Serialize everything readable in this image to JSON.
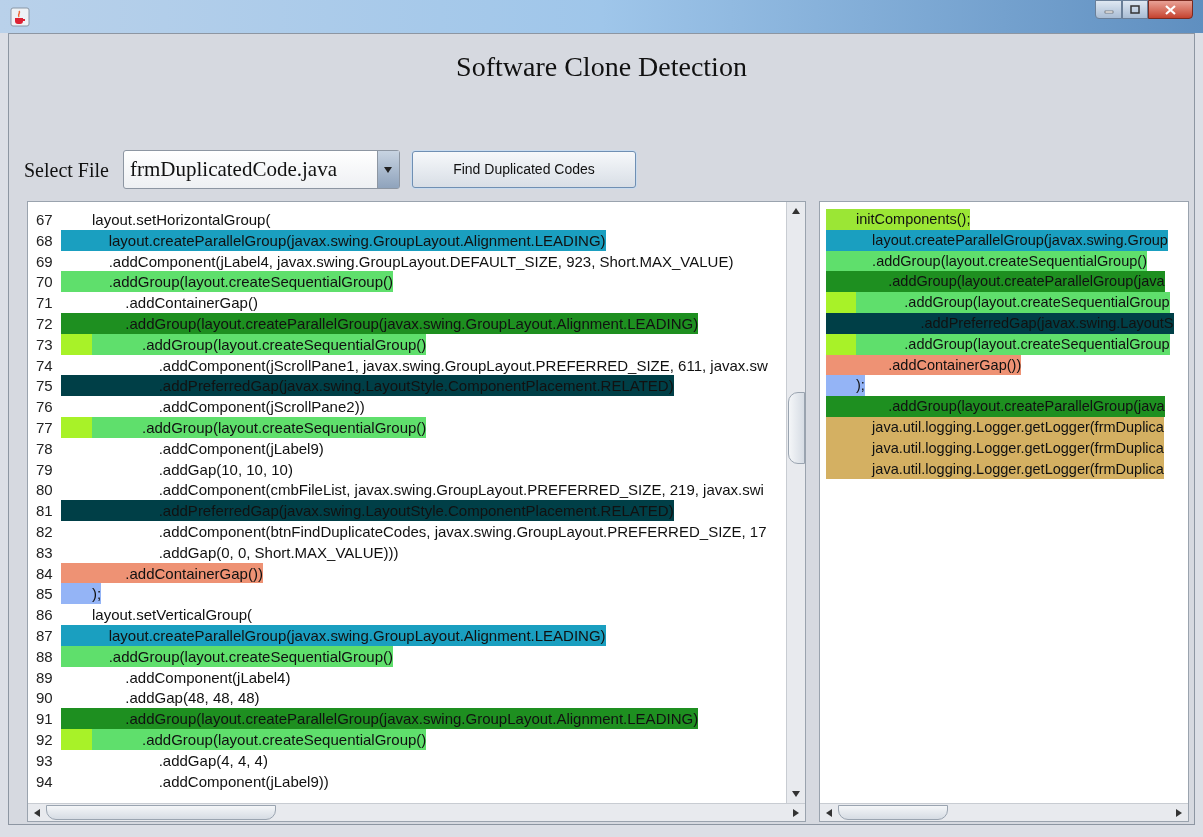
{
  "title": "Software Clone Detection",
  "select_file": {
    "label": "Select File",
    "value": "frmDuplicatedCode.java"
  },
  "buttons": [
    "Find Duplicated Codes"
  ],
  "source_pane": {
    "lines": [
      {
        "number": "67",
        "text": "layout.setHorizontalGroup(",
        "marked": false
      },
      {
        "number": "68",
        "text": "    layout.createParallelGroup(javax.swing.GroupLayout.Alignment.LEADING)",
        "color": "#1a9fc0",
        "marked": false
      },
      {
        "number": "69",
        "text": "    .addComponent(jLabel4, javax.swing.GroupLayout.DEFAULT_SIZE, 923, Short.MAX_VALUE)",
        "marked": false
      },
      {
        "number": "70",
        "text": "    .addGroup(layout.createSequentialGroup()",
        "color": "#5fdf6c",
        "marked": false
      },
      {
        "number": "71",
        "text": "        .addContainerGap()",
        "marked": false
      },
      {
        "number": "72",
        "text": "        .addGroup(layout.createParallelGroup(javax.swing.GroupLayout.Alignment.LEADING)",
        "color": "#1e8f20",
        "marked": false
      },
      {
        "number": "73",
        "text": "            .addGroup(layout.createSequentialGroup()",
        "color": "#5fdf6c",
        "marked": true
      },
      {
        "number": "74",
        "text": "                .addComponent(jScrollPane1, javax.swing.GroupLayout.PREFERRED_SIZE, 611, javax.sw",
        "marked": false
      },
      {
        "number": "75",
        "text": "                .addPreferredGap(javax.swing.LayoutStyle.ComponentPlacement.RELATED)",
        "color": "#003f47",
        "marked": false
      },
      {
        "number": "76",
        "text": "                .addComponent(jScrollPane2))",
        "marked": false
      },
      {
        "number": "77",
        "text": "            .addGroup(layout.createSequentialGroup()",
        "color": "#5fdf6c",
        "marked": true
      },
      {
        "number": "78",
        "text": "                .addComponent(jLabel9)",
        "marked": false
      },
      {
        "number": "79",
        "text": "                .addGap(10, 10, 10)",
        "marked": false
      },
      {
        "number": "80",
        "text": "                .addComponent(cmbFileList, javax.swing.GroupLayout.PREFERRED_SIZE, 219, javax.swi",
        "marked": false
      },
      {
        "number": "81",
        "text": "                .addPreferredGap(javax.swing.LayoutStyle.ComponentPlacement.RELATED)",
        "color": "#003f47",
        "marked": false
      },
      {
        "number": "82",
        "text": "                .addComponent(btnFindDuplicateCodes, javax.swing.GroupLayout.PREFERRED_SIZE, 17",
        "marked": false
      },
      {
        "number": "83",
        "text": "                .addGap(0, 0, Short.MAX_VALUE)))",
        "marked": false
      },
      {
        "number": "84",
        "text": "        .addContainerGap())",
        "color": "#ee9274",
        "marked": false
      },
      {
        "number": "85",
        "text": ");",
        "color": "#94b4f6",
        "marked": false
      },
      {
        "number": "86",
        "text": "layout.setVerticalGroup(",
        "marked": false
      },
      {
        "number": "87",
        "text": "    layout.createParallelGroup(javax.swing.GroupLayout.Alignment.LEADING)",
        "color": "#1a9fc0",
        "marked": false
      },
      {
        "number": "88",
        "text": "    .addGroup(layout.createSequentialGroup()",
        "color": "#5fdf6c",
        "marked": false
      },
      {
        "number": "89",
        "text": "        .addComponent(jLabel4)",
        "marked": false
      },
      {
        "number": "90",
        "text": "        .addGap(48, 48, 48)",
        "marked": false
      },
      {
        "number": "91",
        "text": "        .addGroup(layout.createParallelGroup(javax.swing.GroupLayout.Alignment.LEADING)",
        "color": "#1e8f20",
        "marked": false
      },
      {
        "number": "92",
        "text": "            .addGroup(layout.createSequentialGroup()",
        "color": "#5fdf6c",
        "marked": true
      },
      {
        "number": "93",
        "text": "                .addGap(4, 4, 4)",
        "marked": false
      },
      {
        "number": "94",
        "text": "                .addComponent(jLabel9))",
        "marked": false
      }
    ]
  },
  "clone_pane": {
    "lines": [
      {
        "text": "initComponents();",
        "color": "#9be635",
        "marked": false
      },
      {
        "text": "    layout.createParallelGroup(javax.swing.Group",
        "color": "#1a9fc0",
        "marked": false
      },
      {
        "text": "    .addGroup(layout.createSequentialGroup()",
        "color": "#5fdf6c",
        "marked": false
      },
      {
        "text": "        .addGroup(layout.createParallelGroup(java",
        "color": "#1e8f20",
        "marked": false
      },
      {
        "text": "            .addGroup(layout.createSequentialGroup",
        "color": "#5fdf6c",
        "marked": true
      },
      {
        "text": "                .addPreferredGap(javax.swing.LayoutS",
        "color": "#003f47",
        "marked": false
      },
      {
        "text": "            .addGroup(layout.createSequentialGroup",
        "color": "#5fdf6c",
        "marked": true
      },
      {
        "text": "        .addContainerGap())",
        "color": "#ee9274",
        "marked": false
      },
      {
        "text": ");",
        "color": "#94b4f6",
        "marked": false
      },
      {
        "text": "        .addGroup(layout.createParallelGroup(java",
        "color": "#1e8f20",
        "marked": false
      },
      {
        "text": "    java.util.logging.Logger.getLogger(frmDuplica",
        "color": "#d4b062",
        "marked": false
      },
      {
        "text": "    java.util.logging.Logger.getLogger(frmDuplica",
        "color": "#d4b062",
        "marked": false
      },
      {
        "text": "    java.util.logging.Logger.getLogger(frmDuplica",
        "color": "#d4b062",
        "marked": false
      }
    ]
  }
}
